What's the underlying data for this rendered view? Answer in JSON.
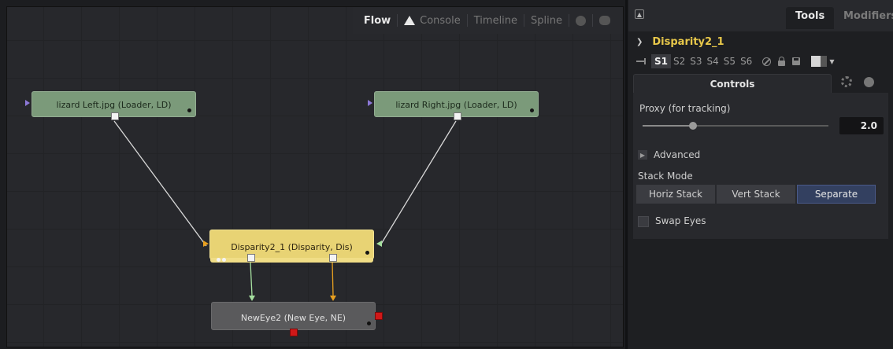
{
  "flow": {
    "tabs": [
      {
        "label": "Flow",
        "active": true
      },
      {
        "label": "Console",
        "icon": "warning-icon"
      },
      {
        "label": "Timeline"
      },
      {
        "label": "Spline"
      }
    ],
    "extra_icons": [
      "info-icon",
      "chat-icon"
    ],
    "nodes": {
      "loader_left": "lizard Left.jpg  (Loader, LD)",
      "loader_right": "lizard Right.jpg  (Loader, LD)",
      "disparity": "Disparity2_1  (Disparity, Dis)",
      "neweye": "NewEye2  (New Eye, NE)"
    },
    "colors": {
      "loader": "#7b9a7a",
      "disparity": "#e8d374",
      "neweye": "#5a5a5c",
      "wire_white": "#d8d8d8",
      "wire_green": "#a6e0a0",
      "wire_orange": "#e8a020"
    }
  },
  "inspector": {
    "tabs": {
      "tools": "Tools",
      "modifiers": "Modifiers"
    },
    "tool_name": "Disparity2_1",
    "slots": [
      "S1",
      "S2",
      "S3",
      "S4",
      "S5",
      "S6"
    ],
    "active_slot": "S1",
    "subtabs": {
      "controls": "Controls"
    },
    "controls": {
      "proxy_label": "Proxy (for tracking)",
      "proxy_value": "2.0",
      "proxy_fraction": 0.27,
      "advanced_label": "Advanced",
      "stack_mode_label": "Stack Mode",
      "stack_buttons": [
        "Horiz Stack",
        "Vert Stack",
        "Separate"
      ],
      "stack_selected": "Separate",
      "swap_eyes_label": "Swap Eyes",
      "swap_eyes_checked": false
    },
    "accent": "#e8c84a",
    "selection_color": "#334060"
  }
}
